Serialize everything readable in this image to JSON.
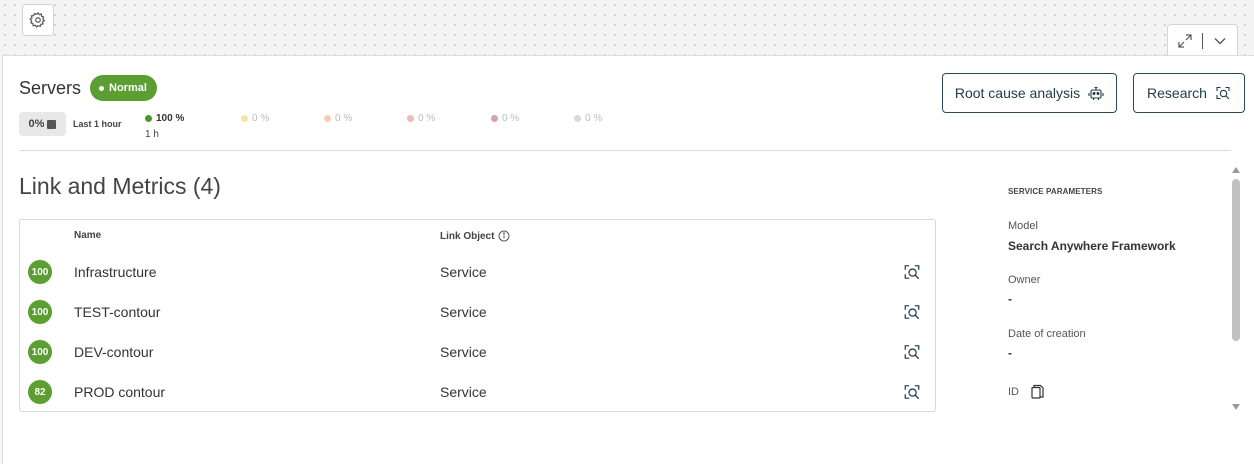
{
  "header": {
    "title": "Servers",
    "status_badge": "Normal",
    "availability_pct": "0%",
    "period_label": "Last 1 hour",
    "legend": [
      {
        "label": "100 %",
        "color": "#4a9a2a"
      },
      {
        "label": "0 %",
        "color": "#f5e3a8"
      },
      {
        "label": "0 %",
        "color": "#f6cfb0"
      },
      {
        "label": "0 %",
        "color": "#f1b6b6"
      },
      {
        "label": "0 %",
        "color": "#d9a3ad"
      },
      {
        "label": "0 %",
        "color": "#d9d9d9"
      }
    ],
    "legend_sub": "1 h",
    "root_cause_label": "Root cause analysis",
    "research_label": "Research"
  },
  "section": {
    "title": "Link and Metrics (4)",
    "columns": {
      "name": "Name",
      "link_object": "Link Object"
    },
    "rows": [
      {
        "score": "100",
        "name": "Infrastructure",
        "link_object": "Service"
      },
      {
        "score": "100",
        "name": "TEST-contour",
        "link_object": "Service"
      },
      {
        "score": "100",
        "name": "DEV-contour",
        "link_object": "Service"
      },
      {
        "score": "82",
        "name": "PROD contour",
        "link_object": "Service"
      }
    ]
  },
  "service_parameters": {
    "heading": "SERVICE PARAMETERS",
    "model_label": "Model",
    "model_value": "Search Anywhere Framework",
    "owner_label": "Owner",
    "owner_value": "-",
    "date_label": "Date of creation",
    "date_value": "-",
    "id_label": "ID"
  },
  "colors": {
    "accent_green": "#5c9e31",
    "button_border": "#2a4a5a"
  },
  "icons": [
    "gear-icon",
    "expand-icon",
    "chevron-down-icon",
    "robot-icon",
    "research-icon",
    "info-icon",
    "copy-icon"
  ]
}
